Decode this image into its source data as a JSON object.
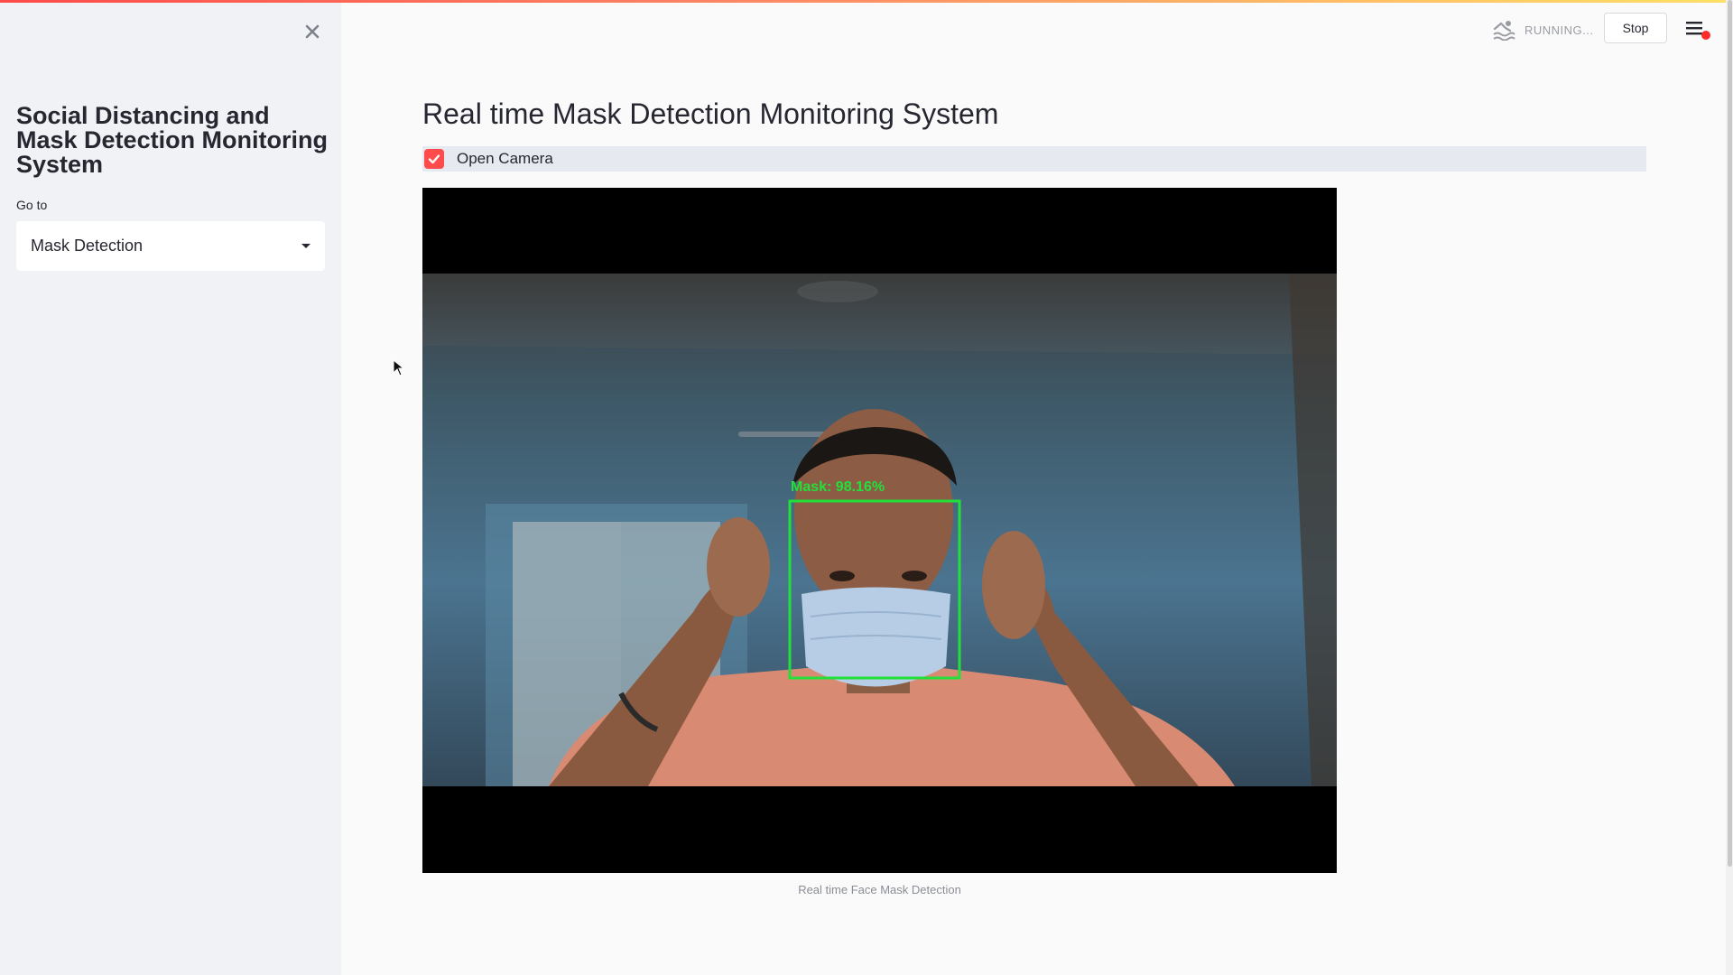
{
  "sidebar": {
    "title": "Social Distancing and Mask Detection Monitoring System",
    "goto_label": "Go to",
    "select_value": "Mask Detection",
    "close_icon": "close-icon"
  },
  "main": {
    "title": "Real time Mask Detection Monitoring System",
    "checkbox_label": "Open Camera",
    "checkbox_checked": true,
    "video_overlay_label": "Mask: 98.16%",
    "caption": "Real time Face Mask Detection"
  },
  "header": {
    "status_text": "RUNNING...",
    "stop_label": "Stop",
    "status_icon": "running-swimmer-icon",
    "menu_icon": "hamburger-menu-icon"
  },
  "colors": {
    "accent": "#ff4b4b",
    "sidebar_bg": "#f0f2f6",
    "detection_box": "#22e03a"
  }
}
